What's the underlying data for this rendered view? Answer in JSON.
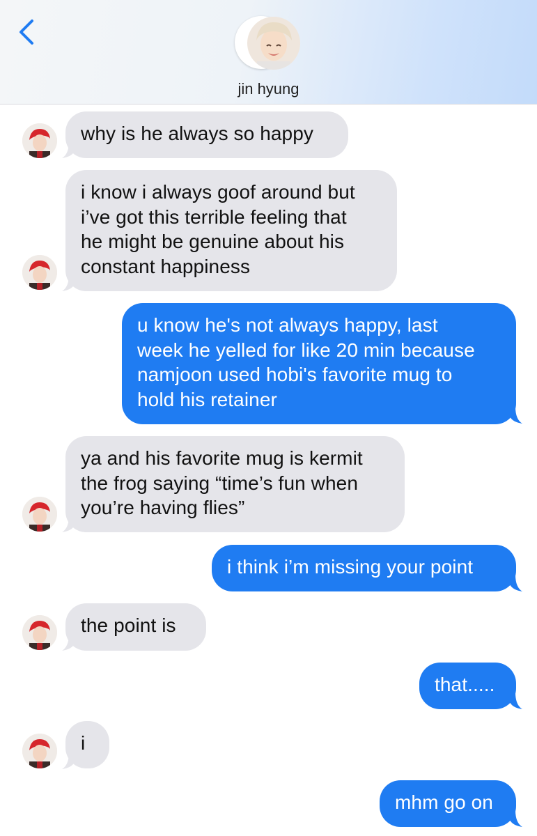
{
  "header": {
    "contact_name": "jin hyung",
    "back_icon": "chevron-left-icon",
    "accent_color": "#1f7cf2"
  },
  "messages": [
    {
      "from": "contact",
      "text": "why is he always so happy"
    },
    {
      "from": "contact",
      "text": "i know i always goof around but\ni’ve got this terrible feeling that\nhe might be genuine about his\nconstant happiness"
    },
    {
      "from": "me",
      "text": "u know he's not always happy, last\nweek he yelled for like 20 min because\nnamjoon used hobi's favorite mug to\nhold his retainer"
    },
    {
      "from": "contact",
      "text": "ya and his favorite mug is kermit\nthe frog saying “time’s fun when\nyou’re having flies”"
    },
    {
      "from": "me",
      "text": "i think i’m missing your point"
    },
    {
      "from": "contact",
      "text": "the point is"
    },
    {
      "from": "me",
      "text": "that....."
    },
    {
      "from": "contact",
      "text": "i"
    },
    {
      "from": "me",
      "text": "mhm go on"
    }
  ],
  "colors": {
    "incoming_bubble": "#e5e5ea",
    "outgoing_bubble": "#1f7cf2"
  }
}
